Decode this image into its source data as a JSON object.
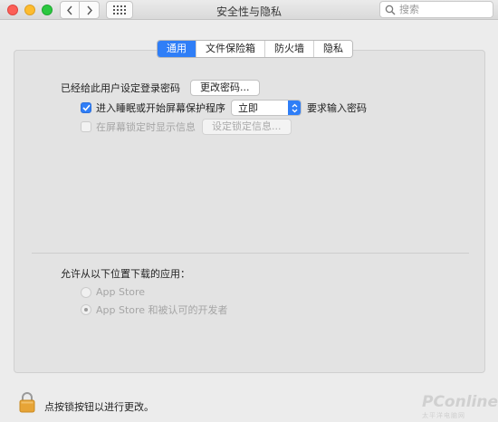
{
  "window": {
    "title": "安全性与隐私"
  },
  "search": {
    "placeholder": "搜索"
  },
  "tabs": [
    {
      "label": "通用",
      "active": true
    },
    {
      "label": "文件保险箱",
      "active": false
    },
    {
      "label": "防火墙",
      "active": false
    },
    {
      "label": "隐私",
      "active": false
    }
  ],
  "general": {
    "password_label": "已经给此用户设定登录密码",
    "change_password_button": "更改密码...",
    "sleep_checkbox": {
      "label": "进入睡眠或开始屏幕保护程序",
      "checked": true
    },
    "sleep_select": {
      "value": "立即"
    },
    "require_password_label": "要求输入密码",
    "lock_message_checkbox": {
      "label": "在屏幕锁定时显示信息",
      "checked": false,
      "disabled": true
    },
    "set_lock_message_button": "设定锁定信息..."
  },
  "downloads": {
    "heading": "允许从以下位置下载的应用：",
    "options": [
      {
        "label": "App Store",
        "selected": false
      },
      {
        "label": "App Store 和被认可的开发者",
        "selected": true
      }
    ]
  },
  "footer": {
    "lock_text": "点按锁按钮以进行更改。"
  },
  "watermark": {
    "brand": "PConline",
    "sub": "太平洋电脑网"
  },
  "colors": {
    "accent": "#2f7ef7",
    "close": "#fc5f57",
    "minimize": "#fdbc2e",
    "maximize": "#2bc840",
    "lock": "#e7a436"
  },
  "icons": [
    "close-icon",
    "minimize-icon",
    "maximize-icon",
    "chevron-left-icon",
    "chevron-right-icon",
    "grid-icon",
    "search-icon",
    "checkmark-icon",
    "select-arrows-icon",
    "lock-icon"
  ]
}
